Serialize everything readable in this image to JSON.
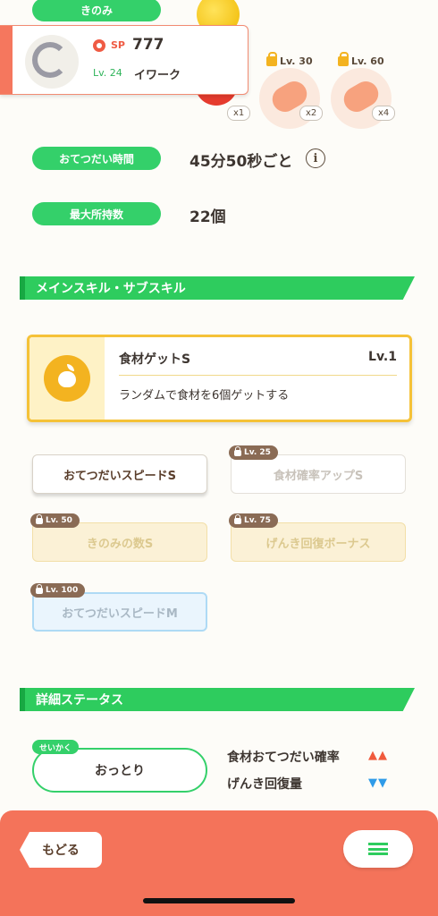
{
  "stats": {
    "berry_label": "きのみ",
    "helping_time_label": "おてつだい時間",
    "helping_time_value": "45分50秒ごと",
    "max_carry_label": "最大所持数",
    "max_carry_value": "22個"
  },
  "pokemon": {
    "sp_label": "SP",
    "sp_value": "777",
    "level": "Lv. 24",
    "name": "イワーク"
  },
  "ingredients": [
    {
      "unlock_level": "Lv. 30",
      "multiplier": "x2"
    },
    {
      "unlock_level": "Lv. 60",
      "multiplier": "x4"
    }
  ],
  "berry_multiplier": "x1",
  "skills_section": {
    "title": "メインスキル・サブスキル",
    "main_skill": {
      "name": "食材ゲットS",
      "level": "Lv.1",
      "description": "ランダムで食材を6個ゲットする"
    },
    "sub_skills": [
      {
        "label": "おてつだいスピードS",
        "unlock_level": ""
      },
      {
        "label": "食材確率アップS",
        "unlock_level": "Lv. 25"
      },
      {
        "label": "きのみの数S",
        "unlock_level": "Lv. 50"
      },
      {
        "label": "げんき回復ボーナス",
        "unlock_level": "Lv. 75"
      },
      {
        "label": "おてつだいスピードM",
        "unlock_level": "Lv. 100"
      }
    ]
  },
  "details_section": {
    "title": "詳細ステータス",
    "nature_tag": "せいかく",
    "nature_value": "おっとり",
    "up_label": "食材おてつだい確率",
    "up_arrows": "▲▲",
    "down_label": "げんき回復量",
    "down_arrows": "▼▼"
  },
  "footer": {
    "back_label": "もどる"
  },
  "colors": {
    "accent_green": "#2ecc5e",
    "footer_orange": "#f4735a",
    "up_color": "#f05a3c",
    "down_color": "#2f9be8"
  }
}
